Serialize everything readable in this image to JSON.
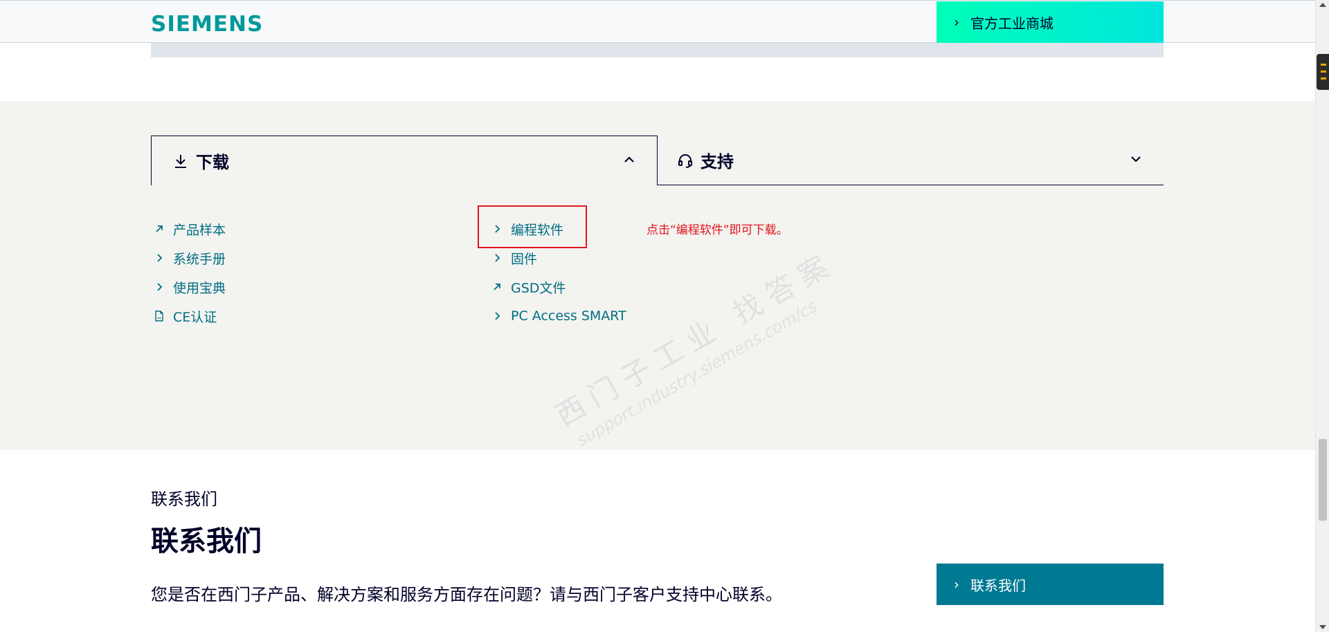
{
  "header": {
    "logo": "SIEMENS",
    "shop_button": "官方工业商城"
  },
  "downloads": {
    "tab_download": "下载",
    "tab_support": "支持",
    "links_left": [
      {
        "label": "产品样本",
        "icon": "external-arrow-icon"
      },
      {
        "label": "系统手册",
        "icon": "chevron-right-icon"
      },
      {
        "label": "使用宝典",
        "icon": "chevron-right-icon"
      },
      {
        "label": "CE认证",
        "icon": "pdf-icon"
      }
    ],
    "links_right": [
      {
        "label": "编程软件",
        "icon": "chevron-right-icon"
      },
      {
        "label": "固件",
        "icon": "chevron-right-icon"
      },
      {
        "label": "GSD文件",
        "icon": "external-arrow-icon"
      },
      {
        "label": "PC Access SMART",
        "icon": "chevron-right-icon"
      }
    ],
    "annotation": "点击“编程软件”即可下载。",
    "watermark_line1": "西门子工业 找答案",
    "watermark_line2": "support.industry.siemens.com/cs"
  },
  "contact": {
    "kicker": "联系我们",
    "title": "联系我们",
    "text": "您是否在西门子产品、解决方案和服务方面存在问题？请与西门子客户支持中心联系。",
    "button": "联系我们"
  },
  "colors": {
    "brand": "#009999",
    "link": "#006e83",
    "highlight": "#e0141e",
    "section_bg": "#f3f3f0",
    "contact_button": "#007993"
  }
}
